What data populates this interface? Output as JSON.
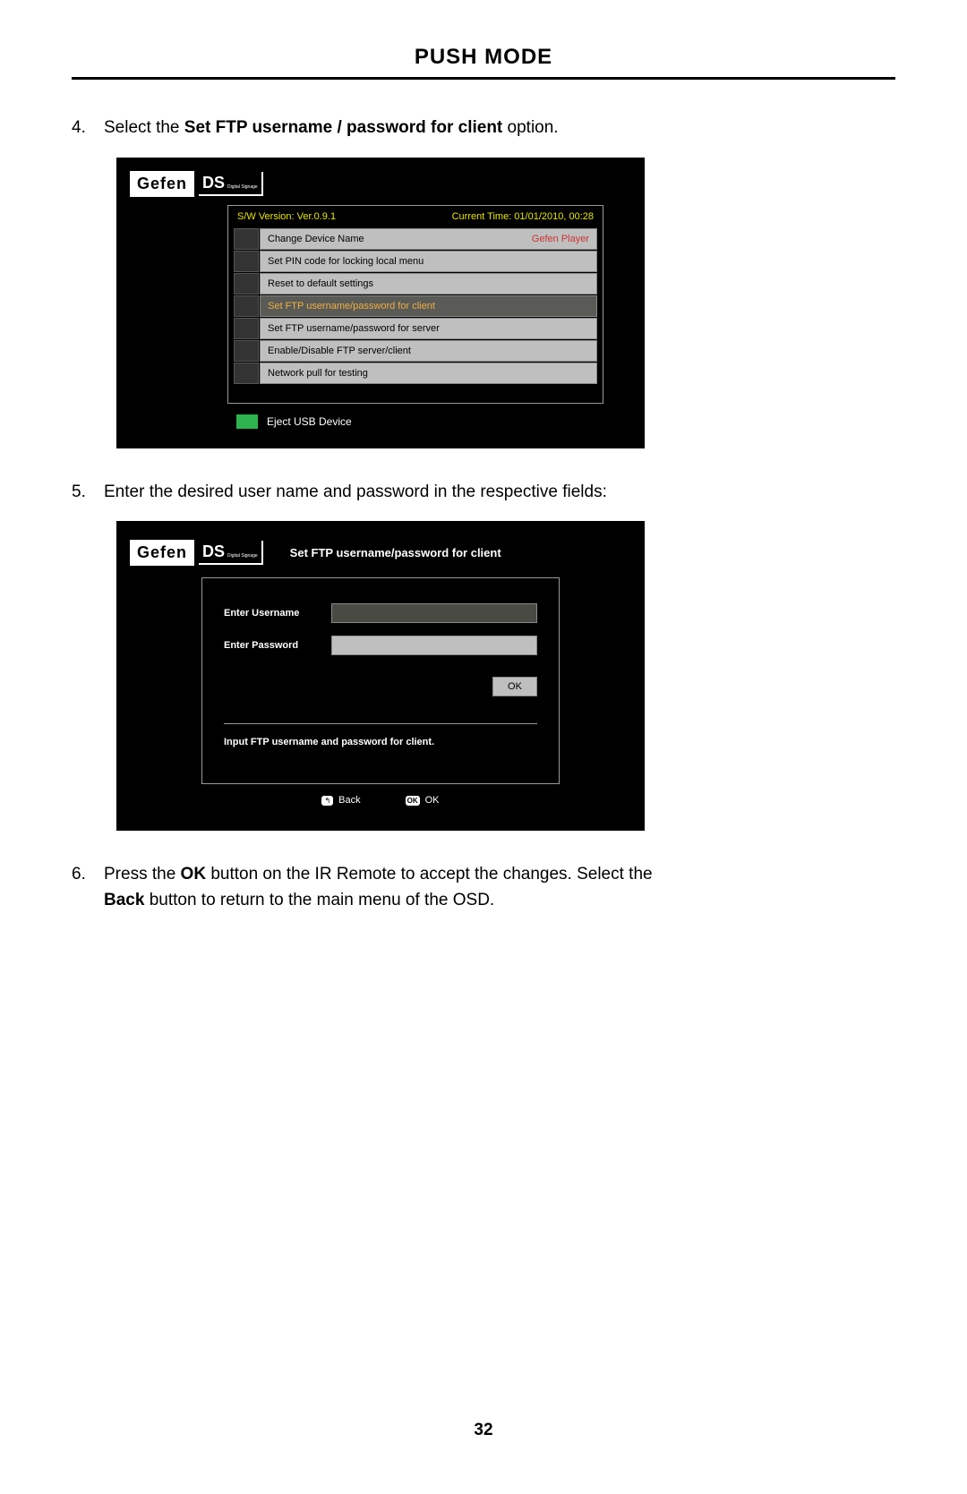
{
  "page_title": "PUSH MODE",
  "page_number": "32",
  "steps": {
    "s4": {
      "num": "4.",
      "prefix": "Select the ",
      "bold": "Set FTP username / password for client",
      "suffix": " option."
    },
    "s5": {
      "num": "5.",
      "text": "Enter the desired user name and password in the respective fields:"
    },
    "s6": {
      "num": "6.",
      "p1a": "Press the ",
      "p1b": "OK",
      "p1c": " button on the IR Remote to accept the changes.  Select the ",
      "p2a": "Back",
      "p2b": " button to return to the main menu of the OSD."
    }
  },
  "logo": {
    "brand": "Gefen",
    "suffix": "DS",
    "sub": "Digital Signage"
  },
  "menu1": {
    "sw_label": "S/W Version: Ver.0.9.1",
    "time_label": "Current Time: 01/01/2010, 00:28",
    "items": [
      {
        "label": "Change Device Name",
        "right": "Gefen Player"
      },
      {
        "label": "Set PIN code for locking local menu",
        "right": ""
      },
      {
        "label": "Reset to default settings",
        "right": ""
      },
      {
        "label": "Set FTP username/password for client",
        "right": ""
      },
      {
        "label": "Set FTP username/password for server",
        "right": ""
      },
      {
        "label": "Enable/Disable FTP server/client",
        "right": ""
      },
      {
        "label": "Network pull for testing",
        "right": ""
      }
    ],
    "eject": "Eject USB Device"
  },
  "form": {
    "title": "Set FTP username/password for client",
    "username_label": "Enter Username",
    "password_label": "Enter Password",
    "ok": "OK",
    "help": "Input FTP username and password for client.",
    "hint_back": "Back",
    "hint_ok_icon": "OK",
    "hint_ok": "OK"
  }
}
